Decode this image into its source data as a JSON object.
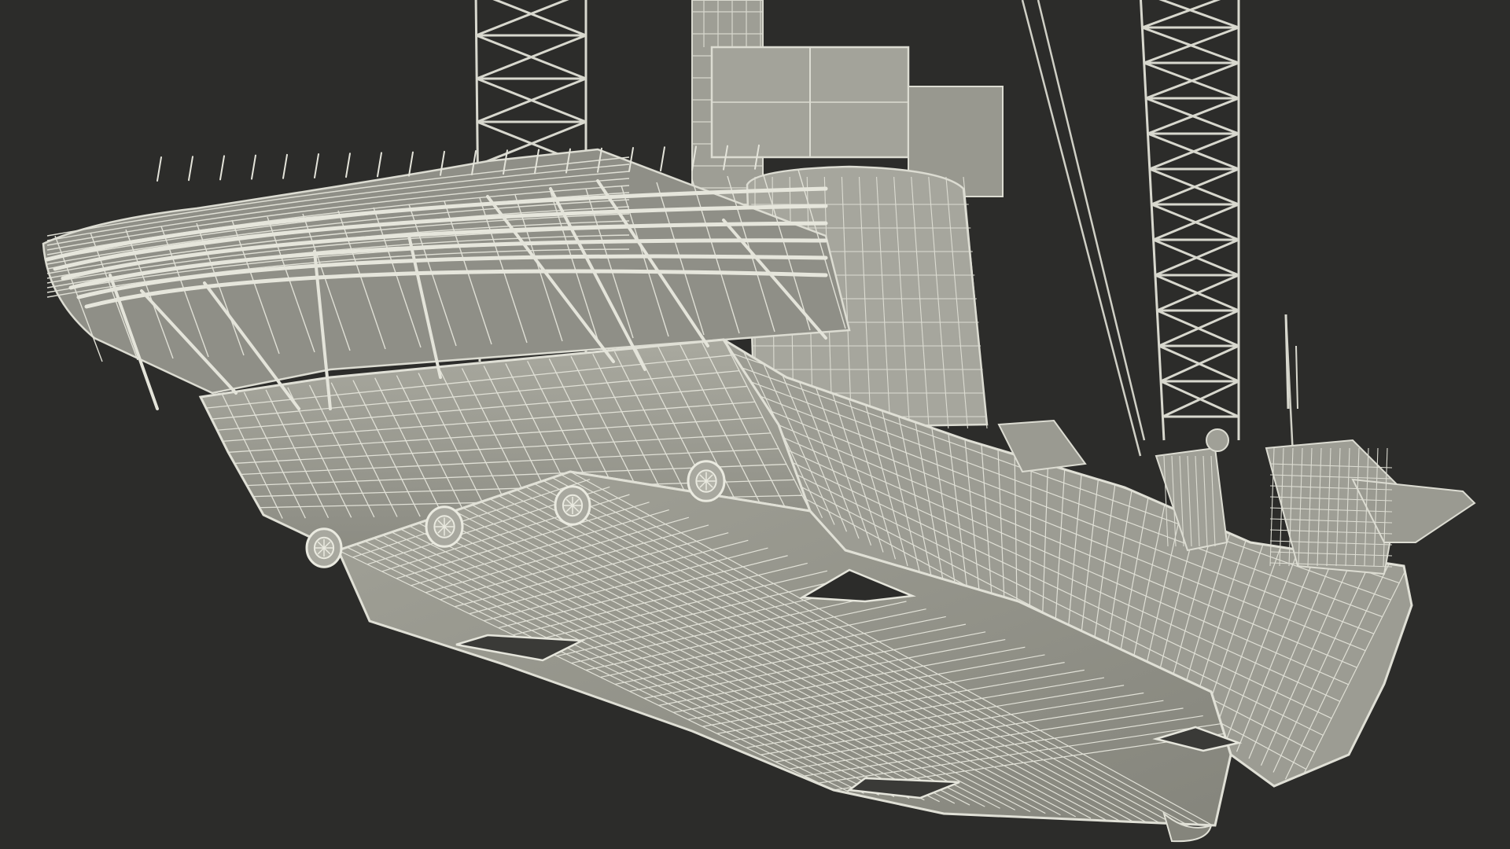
{
  "scene": {
    "subject": "",
    "render_style": "wireframe",
    "colors": {
      "background": "#2c2c2a",
      "wire": "#dcdcd2",
      "surface": "#9a9a90",
      "surface_light": "#b8b8ae",
      "shadow": "#6c6c64"
    }
  }
}
